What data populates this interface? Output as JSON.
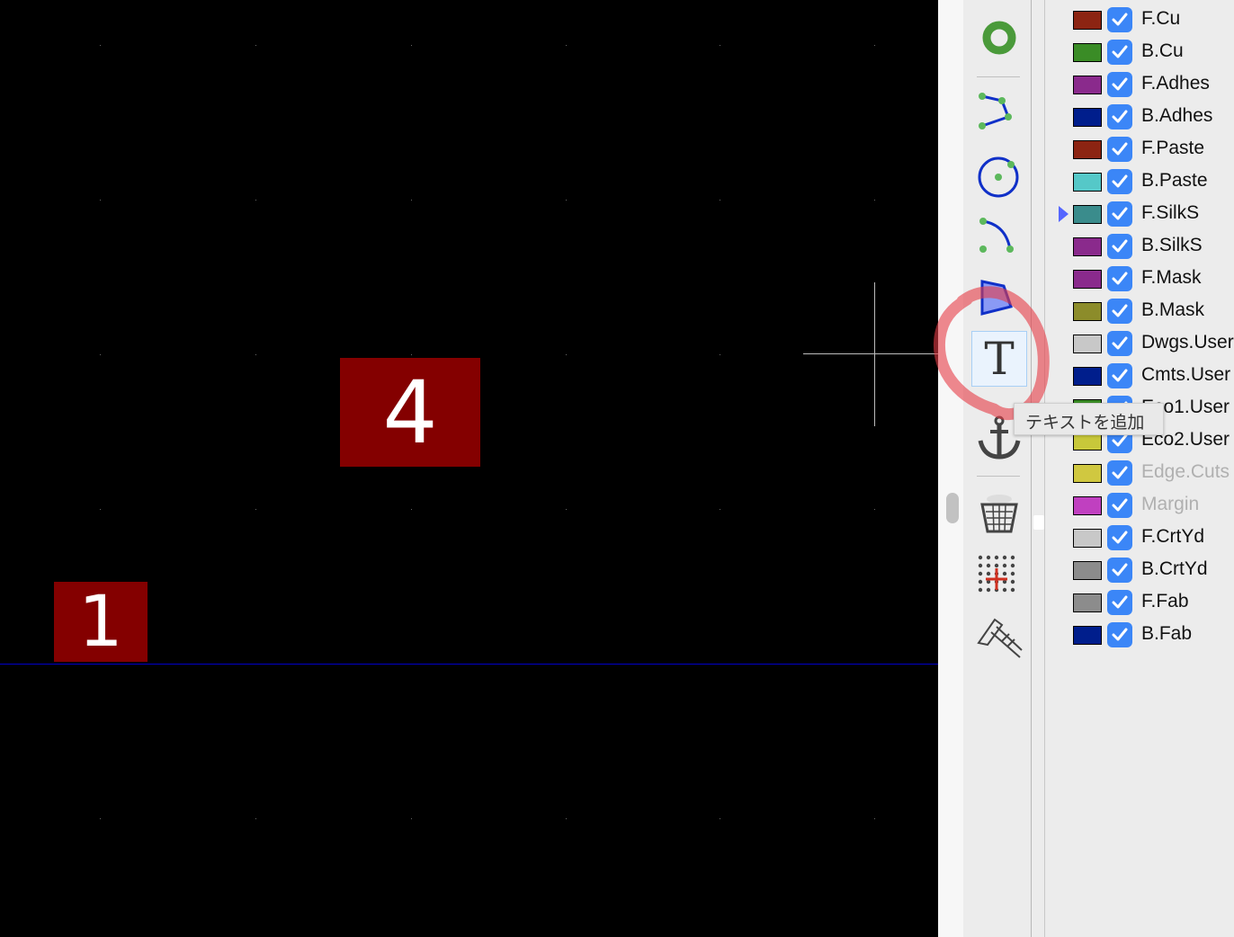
{
  "canvas": {
    "pads": [
      {
        "number": "4"
      },
      {
        "number": "1"
      }
    ],
    "pad_color": "#840000",
    "edge_line_color": "#0000c8"
  },
  "toolbar": {
    "tools": [
      {
        "name": "via-icon"
      },
      {
        "name": "polyline-icon"
      },
      {
        "name": "circle-icon"
      },
      {
        "name": "arc-icon"
      },
      {
        "name": "polygon-icon"
      },
      {
        "name": "text-icon",
        "active": true
      },
      {
        "name": "anchor-icon"
      },
      {
        "name": "delete-icon"
      },
      {
        "name": "grid-origin-icon"
      },
      {
        "name": "measure-icon"
      }
    ]
  },
  "tooltip": {
    "text": "テキストを追加"
  },
  "layers": [
    {
      "name": "F.Cu",
      "color": "#8c2412",
      "checked": true
    },
    {
      "name": "B.Cu",
      "color": "#3a8c26",
      "checked": true
    },
    {
      "name": "F.Adhes",
      "color": "#8a2a8c",
      "checked": true
    },
    {
      "name": "B.Adhes",
      "color": "#001e8c",
      "checked": true
    },
    {
      "name": "F.Paste",
      "color": "#8c2412",
      "checked": true
    },
    {
      "name": "B.Paste",
      "color": "#55c8c8",
      "checked": true
    },
    {
      "name": "F.SilkS",
      "color": "#3a8c8c",
      "checked": true,
      "active": true
    },
    {
      "name": "B.SilkS",
      "color": "#8a2a8c",
      "checked": true
    },
    {
      "name": "F.Mask",
      "color": "#8a2a8c",
      "checked": true
    },
    {
      "name": "B.Mask",
      "color": "#8c8c2a",
      "checked": true
    },
    {
      "name": "Dwgs.User",
      "color": "#c8c8c8",
      "checked": true
    },
    {
      "name": "Cmts.User",
      "color": "#001e8c",
      "checked": true
    },
    {
      "name": "Eco1.User",
      "color": "#3a8c26",
      "checked": true
    },
    {
      "name": "Eco2.User",
      "color": "#c8c83a",
      "checked": true
    },
    {
      "name": "Edge.Cuts",
      "color": "#d0c840",
      "checked": true,
      "dimmed": true
    },
    {
      "name": "Margin",
      "color": "#c040c0",
      "checked": true,
      "dimmed": true
    },
    {
      "name": "F.CrtYd",
      "color": "#c8c8c8",
      "checked": true
    },
    {
      "name": "B.CrtYd",
      "color": "#8c8c8c",
      "checked": true
    },
    {
      "name": "F.Fab",
      "color": "#8c8c8c",
      "checked": true
    },
    {
      "name": "B.Fab",
      "color": "#001e8c",
      "checked": true
    }
  ]
}
